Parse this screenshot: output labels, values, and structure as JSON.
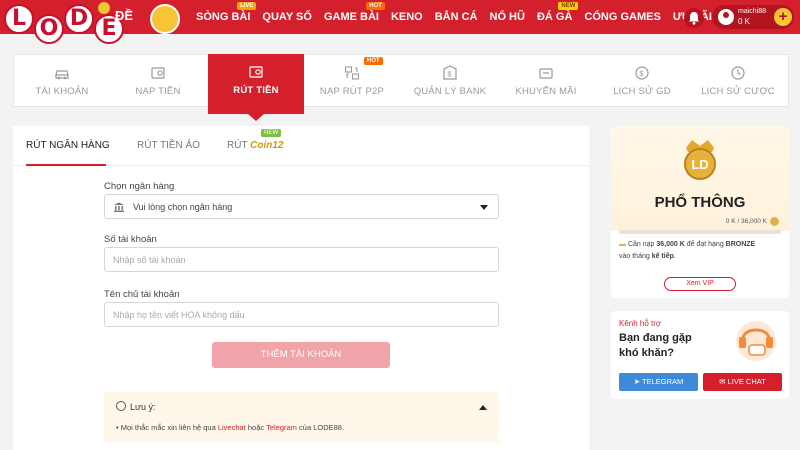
{
  "brand": {
    "logo_letters": [
      "L",
      "O",
      "D",
      "E"
    ],
    "logo_suffix": "ĐỀ"
  },
  "nav": {
    "items": [
      {
        "label": "SÒNG BÀI",
        "badge": "LIVE"
      },
      {
        "label": "QUAY SỐ",
        "badge": ""
      },
      {
        "label": "GAME BÀI",
        "badge": "HOT"
      },
      {
        "label": "KENO",
        "badge": ""
      },
      {
        "label": "BẮN CÁ",
        "badge": ""
      },
      {
        "label": "NỔ HŨ",
        "badge": ""
      },
      {
        "label": "ĐÁ GÀ",
        "badge": "NEW"
      },
      {
        "label": "CỔNG GAMES",
        "badge": ""
      },
      {
        "label": "ƯU ĐÃI",
        "badge": ""
      }
    ]
  },
  "user": {
    "name": "maichi88",
    "balance": "0 K",
    "add_label": "+"
  },
  "tabs": [
    {
      "label": "TÀI KHOẢN",
      "icon": "car-icon"
    },
    {
      "label": "NẠP TIỀN",
      "icon": "deposit-icon"
    },
    {
      "label": "RÚT TIỀN",
      "icon": "withdraw-icon",
      "active": true
    },
    {
      "label": "NẠP RÚT P2P",
      "icon": "p2p-icon",
      "badge": "HOT"
    },
    {
      "label": "QUẢN LÝ BANK",
      "icon": "bank-icon"
    },
    {
      "label": "KHUYẾN MÃI",
      "icon": "promo-icon"
    },
    {
      "label": "LỊCH SỬ GD",
      "icon": "history-icon"
    },
    {
      "label": "LỊCH SỬ CƯỢC",
      "icon": "clock-icon"
    }
  ],
  "subtabs": {
    "bank": "RÚT NGÂN HÀNG",
    "virtual": "RÚT TIỀN ẢO",
    "coin_prefix": "RÚT",
    "coin_name": "Coin12",
    "coin_badge": "NEW"
  },
  "form": {
    "bank_label": "Chọn ngân hàng",
    "bank_placeholder": "Vui lòng chọn ngân hàng",
    "account_label": "Số tài khoản",
    "account_placeholder": "Nhập số tài khoản",
    "holder_label": "Tên chủ tài khoản",
    "holder_placeholder": "Nhập họ tên viết HOA không dấu",
    "submit": "THÊM TÀI KHOẢN"
  },
  "note": {
    "title": "Lưu ý:",
    "text_before": "• Mọi thắc mắc xin liên hệ qua ",
    "livechat": "Livechat",
    "text_mid": " hoặc ",
    "telegram": "Telegram",
    "text_after": " của LODE88."
  },
  "vip": {
    "crown_text": "LD",
    "rank": "PHỔ THÔNG",
    "progress_text": "0 K / 36,000 K",
    "progress": 0,
    "desc_prefix": "Cần nạp ",
    "desc_amount": "36,000 K",
    "desc_mid": " để đạt hạng ",
    "desc_rank": "BRONZE",
    "desc_line2_prefix": "vào tháng ",
    "desc_next": "kế tiếp",
    "button": "Xem VIP"
  },
  "support": {
    "label": "Kênh hỗ trợ",
    "question": "Bạn đang gặp khó khăn?",
    "telegram": "TELEGRAM",
    "livechat": "LIVE CHAT"
  },
  "colors": {
    "primary": "#d4202c",
    "gold": "#f7c533",
    "telegram": "#3f8ad8"
  }
}
